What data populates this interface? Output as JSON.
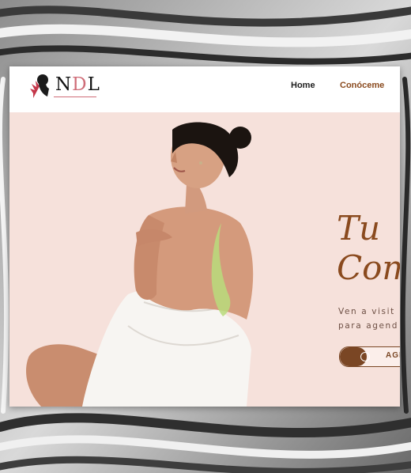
{
  "brand": {
    "logo_prefix": "N",
    "logo_highlight": "D",
    "logo_suffix": "L"
  },
  "nav": {
    "items": [
      {
        "label": "Home"
      },
      {
        "label": "Conóceme"
      }
    ]
  },
  "hero": {
    "headline_line1": "Tu",
    "headline_line2": "Com",
    "subtitle_line1": "Ven a visit",
    "subtitle_line2": "para agend",
    "cta_label": "AGI",
    "cta_icon": "whatsapp-icon",
    "image": "woman-in-white-towel-with-green-back-treatment"
  },
  "colors": {
    "accent": "#8a4a1e",
    "hero_background": "#f6e1db",
    "logo_accent": "#cf6d78"
  }
}
